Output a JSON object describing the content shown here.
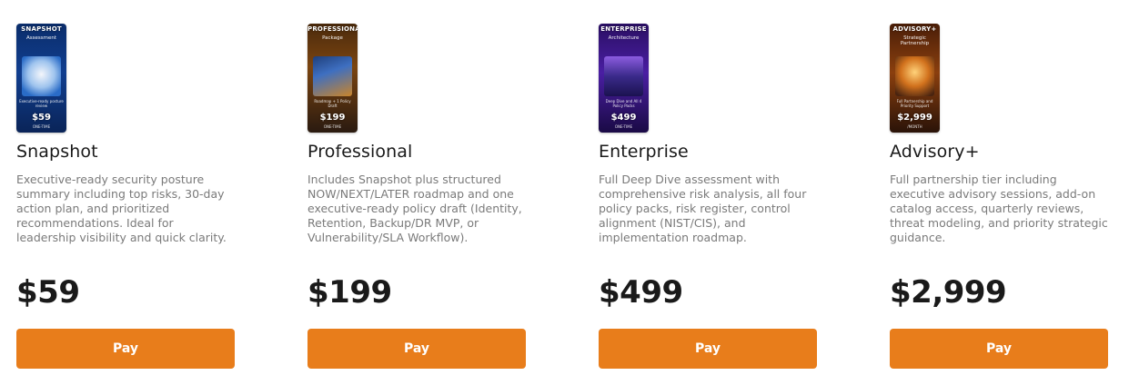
{
  "accent_color": "#e87d1b",
  "plans": [
    {
      "name": "Snapshot",
      "description": "Executive-ready security posture summary including top risks, 30-day action plan, and prioritized recommendations. Ideal for leadership visibility and quick clarity.",
      "price": "$59",
      "button_label": "Pay",
      "thumbnail": {
        "title": "SNAPSHOT",
        "subtitle": "Assessment",
        "caption": "Executive-ready posture review",
        "price": "$59",
        "term": "ONE-TIME"
      }
    },
    {
      "name": "Professional",
      "description": "Includes Snapshot plus structured NOW/NEXT/LATER roadmap and one executive-ready policy draft (Identity, Retention, Backup/DR MVP, or Vulnerability/SLA Workflow).",
      "price": "$199",
      "button_label": "Pay",
      "thumbnail": {
        "title": "PROFESSIONAL",
        "subtitle": "Package",
        "caption": "Roadmap + 1 Policy Draft",
        "price": "$199",
        "term": "ONE-TIME"
      }
    },
    {
      "name": "Enterprise",
      "description": "Full Deep Dive assessment with comprehensive risk analysis, all four policy packs, risk register, control alignment (NIST/CIS), and implementation roadmap.",
      "price": "$499",
      "button_label": "Pay",
      "thumbnail": {
        "title": "ENTERPRISE",
        "subtitle": "Architecture",
        "caption": "Deep Dive and All 4 Policy Packs",
        "price": "$499",
        "term": "ONE-TIME"
      }
    },
    {
      "name": "Advisory+",
      "description": "Full partnership tier including executive advisory sessions, add-on catalog access, quarterly reviews, threat modeling, and priority strategic guidance.",
      "price": "$2,999",
      "button_label": "Pay",
      "thumbnail": {
        "title": "ADVISORY+",
        "subtitle": "Strategic Partnership",
        "caption": "Full Partnership and Priority Support",
        "price": "$2,999",
        "term": "/MONTH"
      }
    }
  ]
}
